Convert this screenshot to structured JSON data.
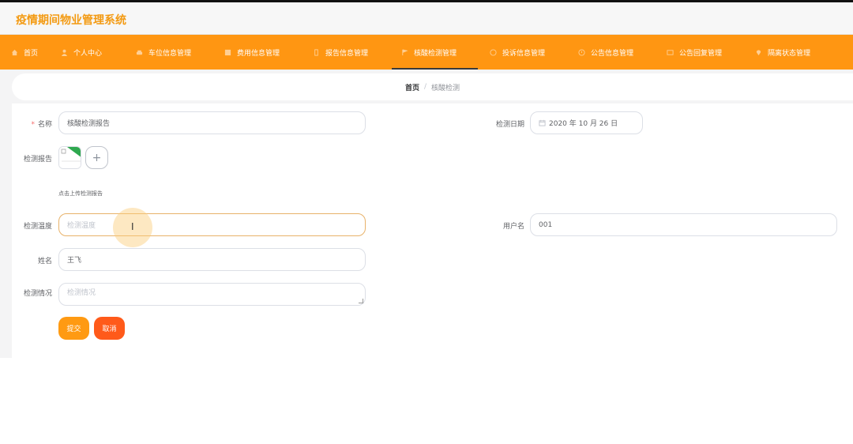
{
  "header": {
    "title": "疫情期间物业管理系统"
  },
  "nav": {
    "items": [
      {
        "label": "首页",
        "icon": "home-icon"
      },
      {
        "label": "个人中心",
        "icon": "user-icon"
      },
      {
        "label": "车位信息管理",
        "icon": "car-icon"
      },
      {
        "label": "费用信息管理",
        "icon": "fee-icon"
      },
      {
        "label": "报告信息管理",
        "icon": "report-icon"
      },
      {
        "label": "核酸检测管理",
        "icon": "flag-icon",
        "active": true
      },
      {
        "label": "投诉信息管理",
        "icon": "complaint-icon"
      },
      {
        "label": "公告信息管理",
        "icon": "notice-icon"
      },
      {
        "label": "公告回复管理",
        "icon": "reply-icon"
      },
      {
        "label": "隔离状态管理",
        "icon": "location-icon"
      }
    ]
  },
  "breadcrumb": {
    "home": "首页",
    "separator": "/",
    "current": "核酸检测"
  },
  "form": {
    "name_label": "名称",
    "name_value": "核酸检测报告",
    "date_label": "检测日期",
    "date_value": "2020 年 10 月 26 日",
    "report_label": "检测报告",
    "upload_plus": "+",
    "upload_hint": "点击上传检测报告",
    "temp_label": "检测温度",
    "temp_placeholder": "检测温度",
    "username_label": "用户名",
    "username_value": "001",
    "person_label": "姓名",
    "person_value": "王飞",
    "status_label": "检测情况",
    "status_placeholder": "检测情况",
    "submit_label": "提交",
    "cancel_label": "取消"
  },
  "colors": {
    "accent": "#ff9612",
    "title": "#f39a12",
    "submit": "#ff9a12",
    "cancel": "#ff5a1a",
    "required": "#f56c6c"
  }
}
